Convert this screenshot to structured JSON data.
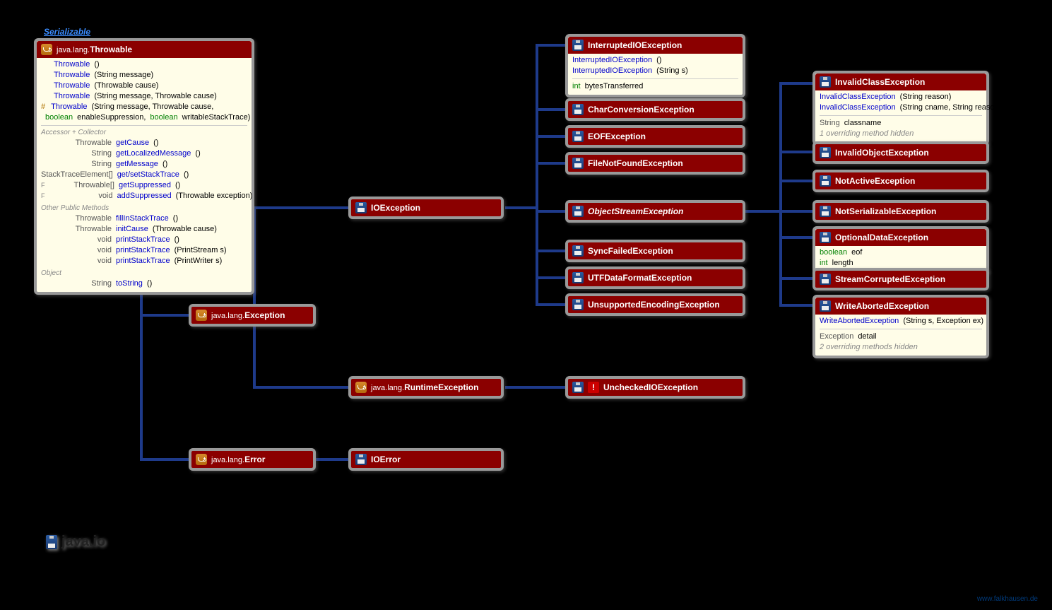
{
  "interface_link": "Serializable",
  "package_label": "java.io",
  "footer_link": "www.falkhausen.de",
  "throwable": {
    "pkg": "java.lang.",
    "name": "Throwable",
    "ctors": [
      {
        "sig": "Throwable",
        "params": "()"
      },
      {
        "sig": "Throwable",
        "params": "(String message)"
      },
      {
        "sig": "Throwable",
        "params": "(Throwable cause)"
      },
      {
        "sig": "Throwable",
        "params": "(String message, Throwable cause)"
      },
      {
        "prot": true,
        "sig": "Throwable",
        "params": "(String message, Throwable cause,",
        "params2": "boolean enableSuppression, boolean writableStackTrace)"
      }
    ],
    "section_accessor": "Accessor + Collector",
    "accessor": [
      {
        "ret": "Throwable",
        "name": "getCause",
        "p": "()"
      },
      {
        "ret": "String",
        "name": "getLocalizedMessage",
        "p": "()"
      },
      {
        "ret": "String",
        "name": "getMessage",
        "p": "()"
      },
      {
        "ret": "StackTraceElement[]",
        "name": "get/setStackTrace",
        "p": "()"
      },
      {
        "mod": "F",
        "ret": "Throwable[]",
        "name": "getSuppressed",
        "p": "()"
      },
      {
        "mod": "F",
        "ret": "void",
        "name": "addSuppressed",
        "p": "(Throwable exception)"
      }
    ],
    "section_other": "Other Public Methods",
    "other": [
      {
        "ret": "Throwable",
        "name": "fillInStackTrace",
        "p": "()"
      },
      {
        "ret": "Throwable",
        "name": "initCause",
        "p": "(Throwable cause)"
      },
      {
        "ret": "void",
        "name": "printStackTrace",
        "p": "()"
      },
      {
        "ret": "void",
        "name": "printStackTrace",
        "p": "(PrintStream s)"
      },
      {
        "ret": "void",
        "name": "printStackTrace",
        "p": "(PrintWriter s)"
      }
    ],
    "section_obj": "Object",
    "obj": [
      {
        "ret": "String",
        "name": "toString",
        "p": "()"
      }
    ]
  },
  "simple": {
    "exception": {
      "pkg": "java.lang.",
      "name": "Exception"
    },
    "ioexception": {
      "name": "IOException"
    },
    "runtime": {
      "pkg": "java.lang.",
      "name": "RuntimeException"
    },
    "error": {
      "pkg": "java.lang.",
      "name": "Error"
    },
    "ioerror": {
      "name": "IOError"
    },
    "unchecked": {
      "name": "UncheckedIOException"
    },
    "charconv": {
      "name": "CharConversionException"
    },
    "eof": {
      "name": "EOFException"
    },
    "fnf": {
      "name": "FileNotFoundException"
    },
    "ose": {
      "name": "ObjectStreamException"
    },
    "syncfail": {
      "name": "SyncFailedException"
    },
    "utf": {
      "name": "UTFDataFormatException"
    },
    "unsupenc": {
      "name": "UnsupportedEncodingException"
    },
    "invobj": {
      "name": "InvalidObjectException"
    },
    "notactive": {
      "name": "NotActiveException"
    },
    "notser": {
      "name": "NotSerializableException"
    },
    "streamcorr": {
      "name": "StreamCorruptedException"
    }
  },
  "interrupted": {
    "name": "InterruptedIOException",
    "ctors": [
      {
        "sig": "InterruptedIOException",
        "p": "()"
      },
      {
        "sig": "InterruptedIOException",
        "p": "(String s)"
      }
    ],
    "field": {
      "type": "int",
      "name": "bytesTransferred"
    }
  },
  "invalidclass": {
    "name": "InvalidClassException",
    "ctors": [
      {
        "sig": "InvalidClassException",
        "p": "(String reason)"
      },
      {
        "sig": "InvalidClassException",
        "p": "(String cname, String reason)"
      }
    ],
    "field": {
      "type": "String",
      "name": "classname"
    },
    "note": "1 overriding method hidden"
  },
  "optdata": {
    "name": "OptionalDataException",
    "fields": [
      {
        "type": "boolean",
        "name": "eof"
      },
      {
        "type": "int",
        "name": "length"
      }
    ]
  },
  "writeabort": {
    "name": "WriteAbortedException",
    "ctor": {
      "sig": "WriteAbortedException",
      "p": "(String s, Exception ex)"
    },
    "field": {
      "type": "Exception",
      "name": "detail"
    },
    "note": "2 overriding methods hidden"
  }
}
